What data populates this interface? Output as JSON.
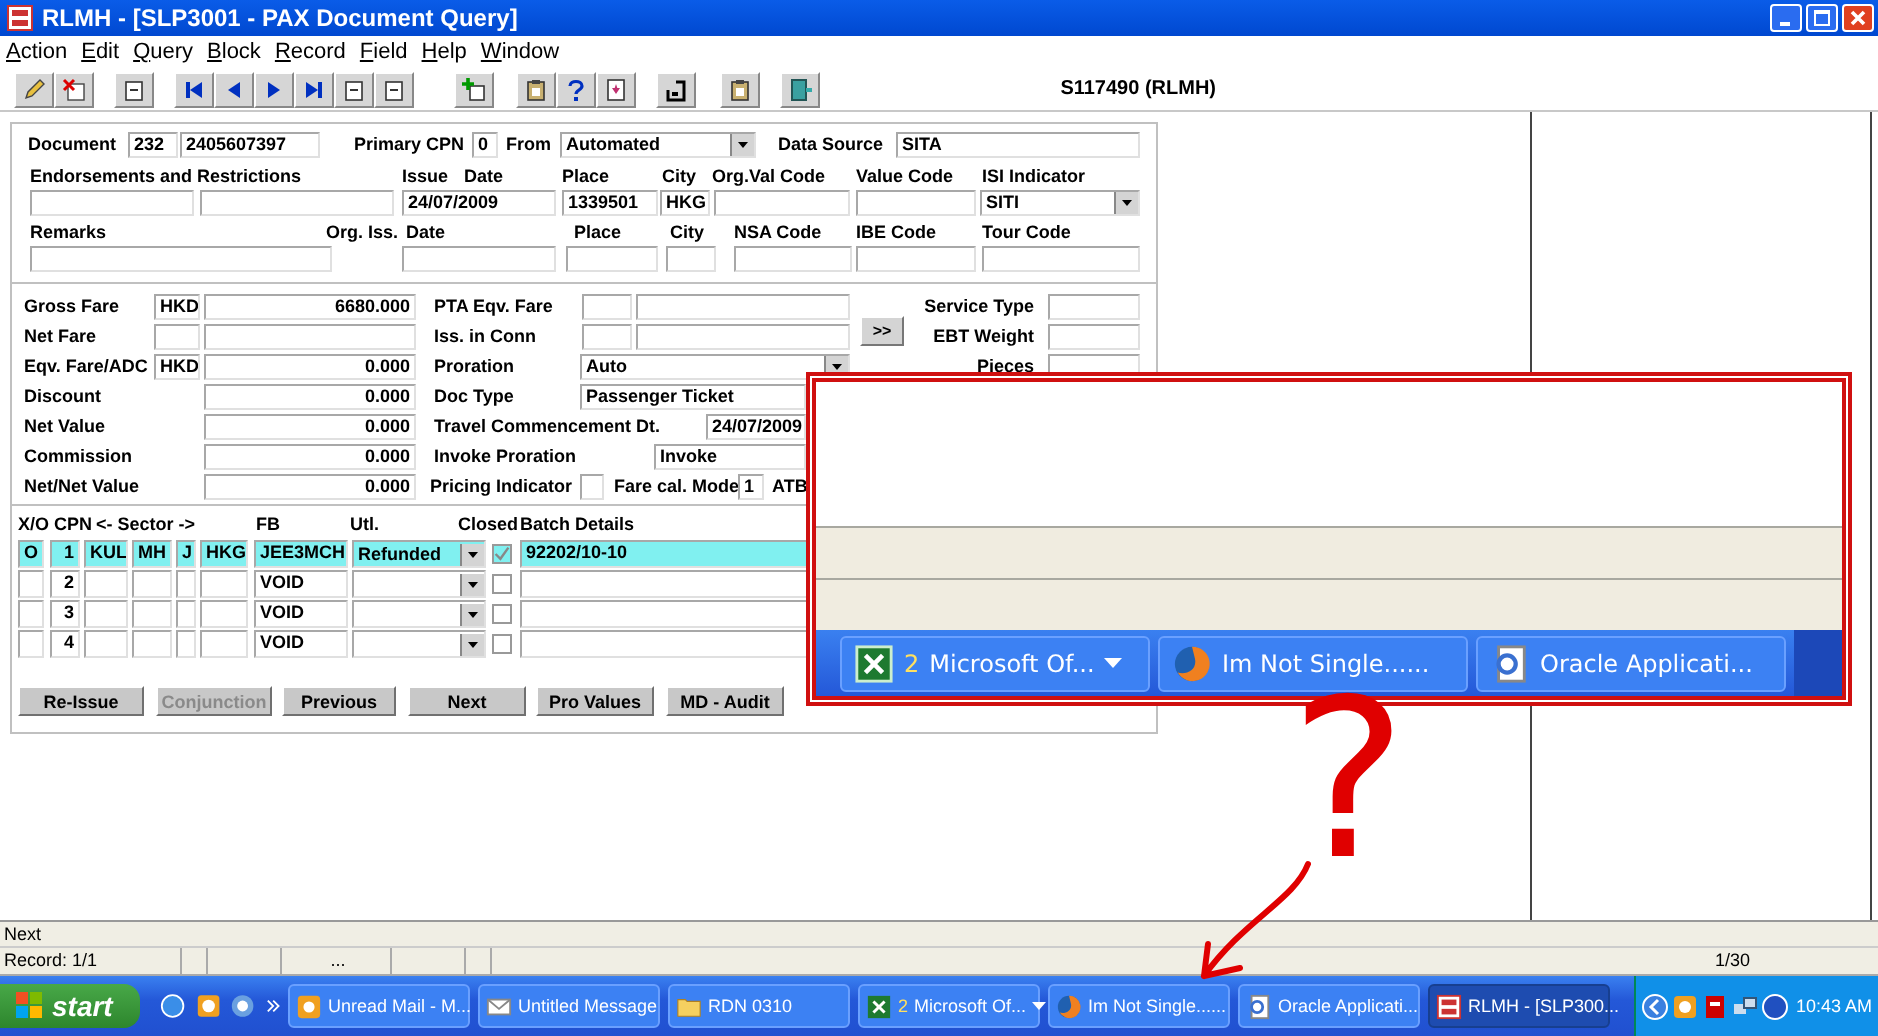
{
  "window": {
    "title": "RLMH - [SLP3001 - PAX Document Query]"
  },
  "menu": [
    {
      "label": "Action"
    },
    {
      "label": "Edit"
    },
    {
      "label": "Query"
    },
    {
      "label": "Block"
    },
    {
      "label": "Record"
    },
    {
      "label": "Field"
    },
    {
      "label": "Help"
    },
    {
      "label": "Window"
    }
  ],
  "toolbar": {
    "user": "S117490 (RLMH)"
  },
  "header_section": {
    "rows": [
      {
        "items": [
          {
            "kind": "label",
            "text": "Document"
          },
          {
            "kind": "field",
            "value": "232"
          },
          {
            "kind": "field",
            "value": "2405607397"
          },
          {
            "kind": "label",
            "text": "Primary CPN"
          },
          {
            "kind": "field",
            "value": "0"
          },
          {
            "kind": "label",
            "text": "From"
          },
          {
            "kind": "select",
            "value": "Automated"
          },
          {
            "kind": "label",
            "text": "Data Source"
          },
          {
            "kind": "field",
            "value": "SITA"
          }
        ]
      },
      {
        "items": [
          {
            "kind": "label",
            "text": "Endorsements and Restrictions"
          },
          {
            "kind": "label",
            "text": "Issue"
          },
          {
            "kind": "label",
            "text": "Date"
          },
          {
            "kind": "label",
            "text": "Place"
          },
          {
            "kind": "label",
            "text": "City"
          },
          {
            "kind": "label",
            "text": "Org.Val Code"
          },
          {
            "kind": "label",
            "text": "Value Code"
          },
          {
            "kind": "label",
            "text": "ISI Indicator"
          }
        ]
      },
      {
        "items": [
          {
            "kind": "field"
          },
          {
            "kind": "field"
          },
          {
            "kind": "field",
            "value": "24/07/2009"
          },
          {
            "kind": "field",
            "value": "1339501"
          },
          {
            "kind": "field",
            "value": "HKG"
          },
          {
            "kind": "field"
          },
          {
            "kind": "field"
          },
          {
            "kind": "select",
            "value": "SITI"
          }
        ]
      },
      {
        "items": [
          {
            "kind": "label",
            "text": "Remarks"
          },
          {
            "kind": "label",
            "text": "Org. Iss."
          },
          {
            "kind": "label",
            "text": "Date"
          },
          {
            "kind": "label",
            "text": "Place"
          },
          {
            "kind": "label",
            "text": "City"
          },
          {
            "kind": "label",
            "text": "NSA Code"
          },
          {
            "kind": "label",
            "text": "IBE Code"
          },
          {
            "kind": "label",
            "text": "Tour Code"
          }
        ]
      },
      {
        "items": [
          {
            "kind": "field"
          },
          {
            "kind": "field"
          },
          {
            "kind": "field"
          },
          {
            "kind": "field"
          },
          {
            "kind": "field"
          },
          {
            "kind": "field"
          },
          {
            "kind": "field"
          }
        ]
      }
    ]
  },
  "fare_section": {
    "rows": [
      {
        "items": [
          {
            "kind": "label",
            "text": "Gross Fare"
          },
          {
            "kind": "field",
            "value": "HKD"
          },
          {
            "kind": "field",
            "value": "6680.000"
          },
          {
            "kind": "label",
            "text": "PTA Eqv. Fare"
          },
          {
            "kind": "field"
          },
          {
            "kind": "field"
          },
          {
            "kind": "label",
            "text": "Service Type"
          },
          {
            "kind": "field"
          }
        ]
      },
      {
        "items": [
          {
            "kind": "label",
            "text": "Net Fare"
          },
          {
            "kind": "field"
          },
          {
            "kind": "field"
          },
          {
            "kind": "label",
            "text": "Iss. in Conn"
          },
          {
            "kind": "field"
          },
          {
            "kind": "field"
          },
          {
            "kind": "button",
            "text": ">>"
          },
          {
            "kind": "label",
            "text": "EBT Weight"
          },
          {
            "kind": "field"
          }
        ]
      },
      {
        "items": [
          {
            "kind": "label",
            "text": "Eqv. Fare/ADC"
          },
          {
            "kind": "field",
            "value": "HKD"
          },
          {
            "kind": "field",
            "value": "0.000"
          },
          {
            "kind": "label",
            "text": "Proration"
          },
          {
            "kind": "select",
            "value": "Auto"
          },
          {
            "kind": "label",
            "text": "Pieces"
          },
          {
            "kind": "field"
          }
        ]
      },
      {
        "items": [
          {
            "kind": "label",
            "text": "Discount"
          },
          {
            "kind": "field",
            "value": "0.000"
          },
          {
            "kind": "label",
            "text": "Doc Type"
          },
          {
            "kind": "field",
            "value": "Passenger Ticket"
          }
        ]
      },
      {
        "items": [
          {
            "kind": "label",
            "text": "Net Value"
          },
          {
            "kind": "field",
            "value": "0.000"
          },
          {
            "kind": "label",
            "text": "Travel Commencement Dt."
          },
          {
            "kind": "field",
            "value": "24/07/2009"
          }
        ]
      },
      {
        "items": [
          {
            "kind": "label",
            "text": "Commission"
          },
          {
            "kind": "field",
            "value": "0.000"
          },
          {
            "kind": "label",
            "text": "Invoke Proration"
          },
          {
            "kind": "field",
            "value": "Invoke"
          }
        ]
      },
      {
        "items": [
          {
            "kind": "label",
            "text": "Net/Net Value"
          },
          {
            "kind": "field",
            "value": "0.000"
          },
          {
            "kind": "label",
            "text": "Pricing Indicator"
          },
          {
            "kind": "field"
          },
          {
            "kind": "label",
            "text": "Fare cal. Mode"
          },
          {
            "kind": "field",
            "value": "1"
          },
          {
            "kind": "label",
            "text": "ATB"
          }
        ]
      }
    ]
  },
  "coupons": {
    "columns": [
      "X/O",
      "CPN",
      "<- Sector ->",
      "FB",
      "Utl.",
      "Closed",
      "Batch Details"
    ],
    "rows": [
      {
        "selected": true,
        "xo": "O",
        "cpn": "1",
        "sector": [
          "KUL",
          "MH",
          "J",
          "HKG"
        ],
        "fb": "JEE3MCH",
        "utl": "Refunded",
        "closed": true,
        "batch": "92202/10-10"
      },
      {
        "selected": false,
        "cpn": "2",
        "fb": "VOID",
        "closed": false
      },
      {
        "selected": false,
        "cpn": "3",
        "fb": "VOID",
        "closed": false
      },
      {
        "selected": false,
        "cpn": "4",
        "fb": "VOID",
        "closed": false
      }
    ]
  },
  "buttons": [
    {
      "label": "Re-Issue",
      "disabled": false
    },
    {
      "label": "Conjunction",
      "disabled": true
    },
    {
      "label": "Previous",
      "disabled": false
    },
    {
      "label": "Next",
      "disabled": false
    },
    {
      "label": "Pro Values",
      "disabled": false
    },
    {
      "label": "MD - Audit",
      "disabled": false
    }
  ],
  "callout": {
    "tasks": [
      {
        "kind": "spreadsheet",
        "count": "2",
        "label": "Microsoft Of...",
        "grouped": true
      },
      {
        "kind": "browser",
        "label": "Im Not Single......",
        "grouped": false
      },
      {
        "kind": "web_page",
        "label": "Oracle Applicati...",
        "grouped": false
      }
    ]
  },
  "annotation": "?",
  "status_bar": {
    "message": "Next",
    "record": "Record: 1/1",
    "field_3": "...",
    "count": "1/30"
  },
  "taskbar": {
    "start": "start",
    "tasks": [
      {
        "kind": "mail",
        "label": "Unread Mail - M...",
        "selected": false
      },
      {
        "kind": "message",
        "label": "Untitled Message",
        "selected": false
      },
      {
        "kind": "folder",
        "label": "RDN 0310",
        "selected": false
      },
      {
        "kind": "spreadsheet",
        "count": "2",
        "label": "Microsoft Of...",
        "selected": false
      },
      {
        "kind": "browser",
        "label": "Im Not Single......",
        "selected": false
      },
      {
        "kind": "web_page",
        "label": "Oracle Applicati...",
        "selected": false
      },
      {
        "kind": "app",
        "label": "RLMH - [SLP300...",
        "selected": true
      }
    ],
    "clock": "10:43 AM"
  }
}
